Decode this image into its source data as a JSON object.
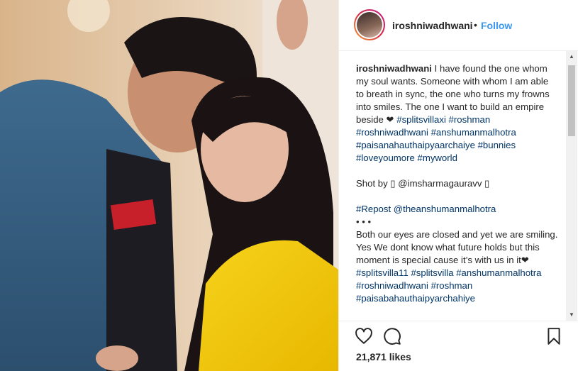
{
  "post": {
    "username": "iroshniwadhwani",
    "separator": "•",
    "follow_label": "Follow",
    "caption": {
      "intro": "I have found the one whom my soul wants. Someone with whom I am able to breath in sync, the one who turns my frowns into smiles. The one I want to build an empire beside ❤ ",
      "hashtags_1": "#splitsvillaxi #roshman #roshniwadhwani #anshumanmalhotra #paisanahauthaipyaarchaiye #bunnies #loveyoumore #myworld",
      "shot_by": "Shot by ▯ @imsharmagauravv ▯",
      "repost": "#Repost @theanshumanmalhotra",
      "bullets": "• • •",
      "body": "Both our eyes are closed and yet we are smiling. Yes We dont know what future holds but this moment is special cause it’s with us in it❤ ",
      "hashtags_2": "#splitsvilla11 #splitsvilla #anshumanmalhotra #roshniwadhwani #roshman #paisabahauthaipyarchahiye"
    },
    "likes": "21,871 likes"
  },
  "icons": {
    "like": "heart-icon",
    "comment": "comment-icon",
    "save": "bookmark-icon"
  },
  "colors": {
    "link": "#3897f0",
    "text": "#262626",
    "hashtag": "#003569",
    "border": "#efefef"
  }
}
